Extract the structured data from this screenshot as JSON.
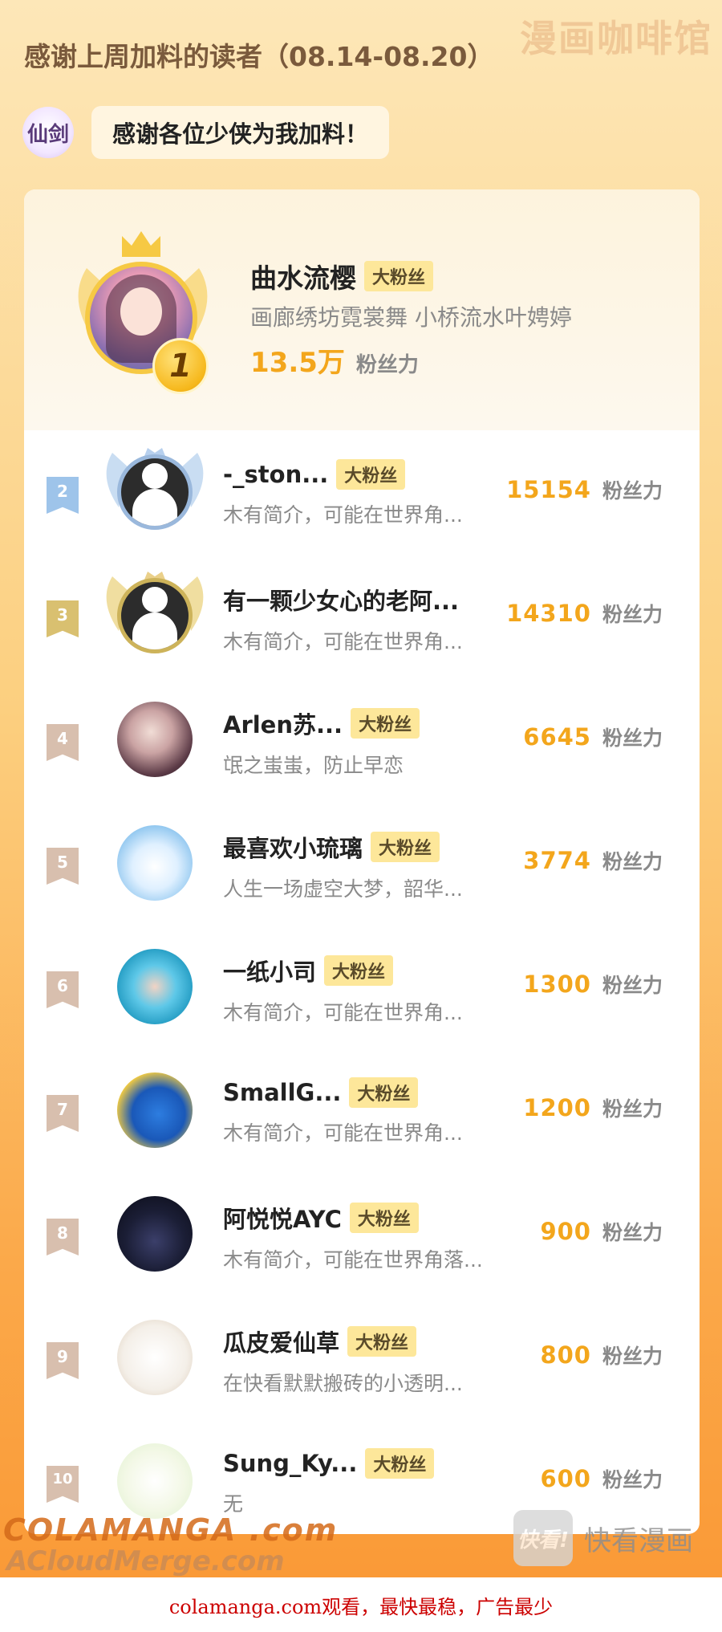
{
  "header": {
    "watermark": "漫画咖啡馆",
    "title": "感谢上周加料的读者（08.14-08.20）",
    "game_logo_text": "仙剑",
    "thanks_text": "感谢各位少侠为我加料！"
  },
  "fan_tag": "大粉丝",
  "score_unit": "粉丝力",
  "champion": {
    "rank": "1",
    "name": "曲水流樱",
    "desc": "画廊绣坊霓裳舞 小桥流水叶娉婷",
    "score": "13.5万"
  },
  "rows": [
    {
      "rank": "2",
      "name": "-_ston...",
      "tag": "大粉丝",
      "desc": "木有简介，可能在世界角...",
      "score": "15154"
    },
    {
      "rank": "3",
      "name": "有一颗少女心的老阿...",
      "tag": "",
      "desc": "木有简介，可能在世界角...",
      "score": "14310"
    },
    {
      "rank": "4",
      "name": "Arlen苏...",
      "tag": "大粉丝",
      "desc": "氓之蚩蚩，防止早恋",
      "score": "6645"
    },
    {
      "rank": "5",
      "name": "最喜欢小琉璃",
      "tag": "大粉丝",
      "desc": "人生一场虚空大梦，韶华...",
      "score": "3774"
    },
    {
      "rank": "6",
      "name": "一纸小司",
      "tag": "大粉丝",
      "desc": "木有简介，可能在世界角...",
      "score": "1300"
    },
    {
      "rank": "7",
      "name": "SmallG...",
      "tag": "大粉丝",
      "desc": "木有简介，可能在世界角...",
      "score": "1200"
    },
    {
      "rank": "8",
      "name": "阿悦悦AYC",
      "tag": "大粉丝",
      "desc": "木有简介，可能在世界角落...",
      "score": "900"
    },
    {
      "rank": "9",
      "name": "瓜皮爱仙草",
      "tag": "大粉丝",
      "desc": "在快看默默搬砖的小透明...",
      "score": "800"
    },
    {
      "rank": "10",
      "name": "Sung_Ky...",
      "tag": "大粉丝",
      "desc": "无",
      "score": "600"
    }
  ],
  "watermarks": {
    "site_line1": "COLAMANGA .com",
    "site_line2": "ACloudMerge.com",
    "kk_logo": "快看!",
    "kk_text": "快看漫画"
  },
  "footer": "colamanga.com观看，最快最稳，广告最少"
}
